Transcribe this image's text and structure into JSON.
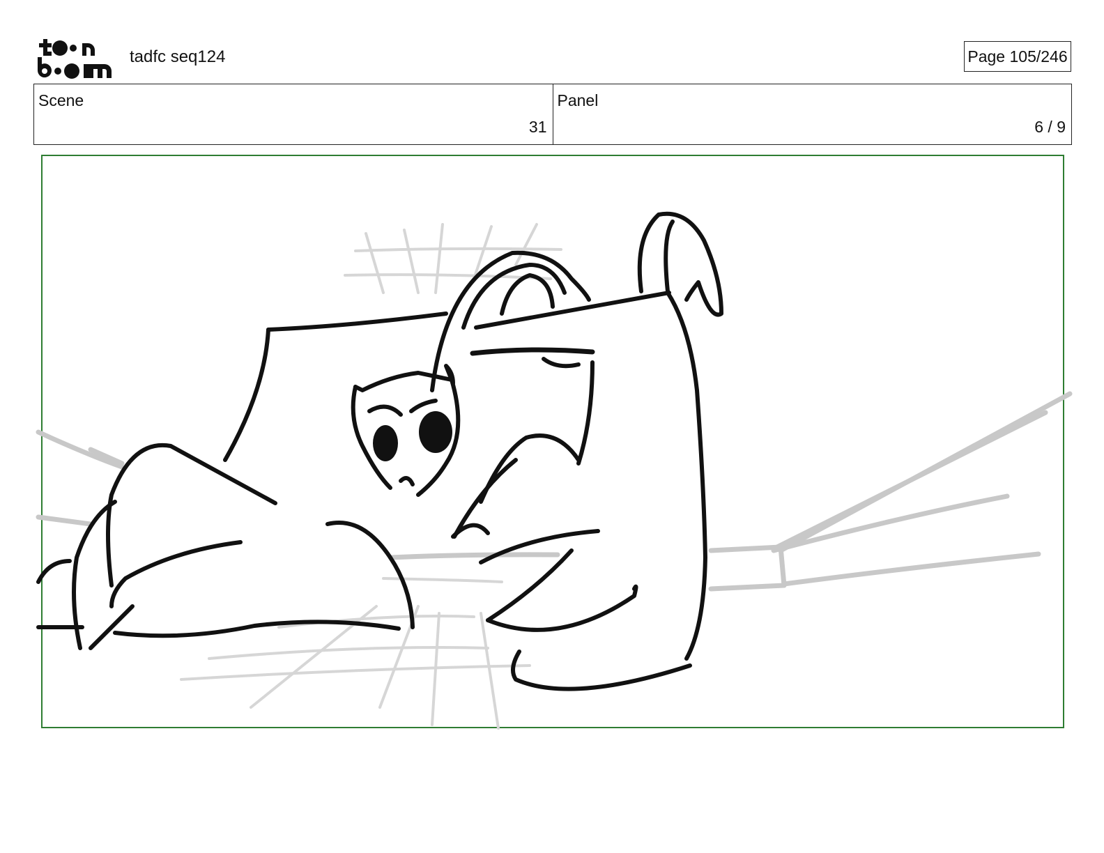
{
  "header": {
    "logo_alt": "toon boom",
    "project_title": "tadfc seq124",
    "page_indicator": "Page 105/246"
  },
  "info": {
    "scene_label": "Scene",
    "scene_value": "31",
    "panel_label": "Panel",
    "panel_value": "6 / 9"
  },
  "panel": {
    "frame_color": "#2e7d32",
    "sketch_description_icon": "storyboard-sketch"
  }
}
